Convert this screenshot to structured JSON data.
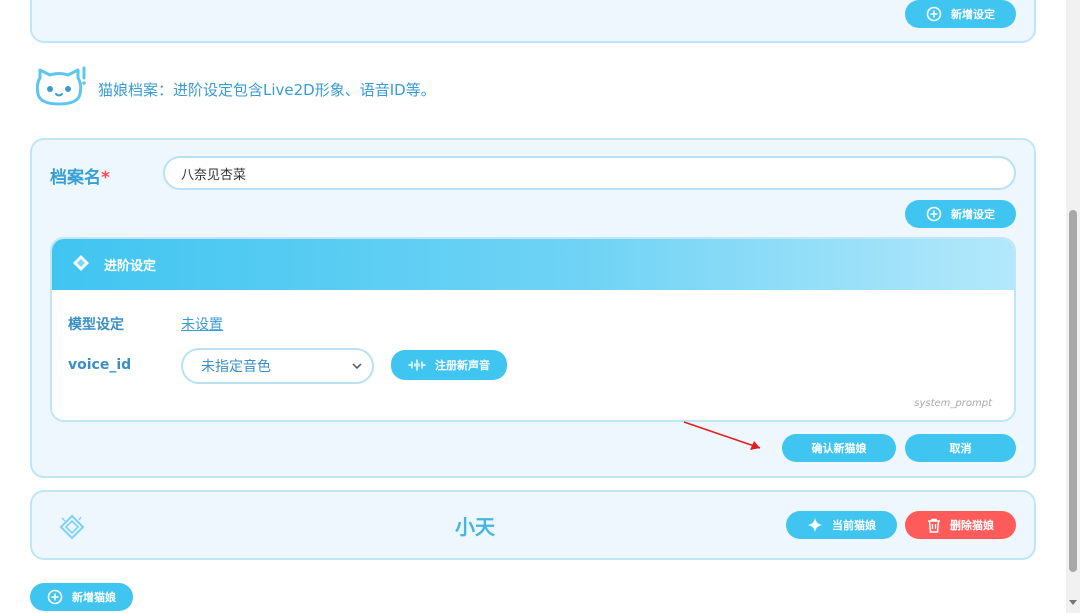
{
  "top_card": {
    "add_setting_label": "新增设定"
  },
  "notice": {
    "text": "猫娘档案：进阶设定包含Live2D形象、语音ID等。"
  },
  "profile_form": {
    "name_label": "档案名",
    "required_mark": "*",
    "name_value": "八奈见杏菜",
    "add_setting_label": "新增设定",
    "advanced": {
      "title": "进阶设定",
      "model_label": "模型设定",
      "model_value": "未设置",
      "voice_label": "voice_id",
      "voice_selected": "未指定音色",
      "register_voice_label": "注册新声音",
      "hint": "system_prompt"
    },
    "confirm_label": "确认新猫娘",
    "cancel_label": "取消"
  },
  "character_card": {
    "name": "小天",
    "current_label": "当前猫娘",
    "delete_label": "删除猫娘"
  },
  "add_catgirl_label": "新增猫娘",
  "colors": {
    "accent": "#40c5f1",
    "danger": "#ff5b5b",
    "card_bg": "#edf7fd",
    "card_border": "#bfe6f6",
    "annotation_arrow": "#e02020"
  }
}
